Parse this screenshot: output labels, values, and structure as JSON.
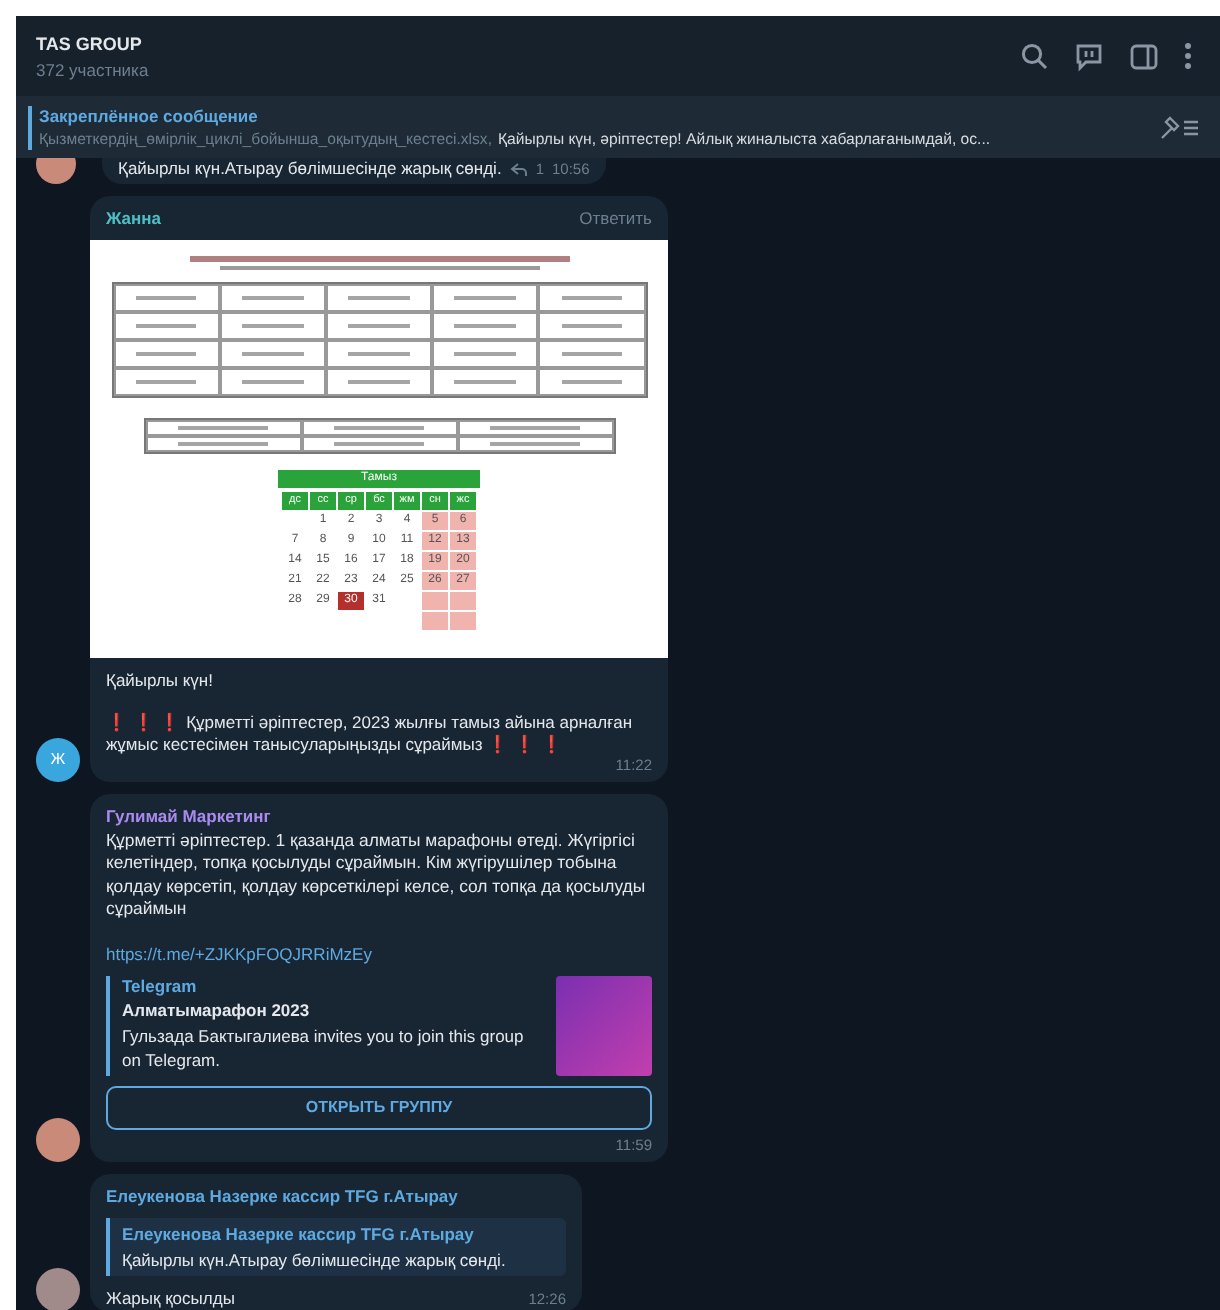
{
  "header": {
    "title": "TAS GROUP",
    "subtitle": "372 участника"
  },
  "pinned": {
    "label": "Закреплённое сообщение",
    "file": "Қызметкердің_өмірлік_циклі_бойынша_оқытудың_кестесі.xlsx,",
    "text": "Қайырлы күн, әріптестер! Айлық жиналыста хабарлағанымдай, ос..."
  },
  "messages": [
    {
      "kind": "partial",
      "text": "Қайырлы күн.Атырау бөлімшесінде жарық сөнді.",
      "replies": "1",
      "time": "10:56"
    },
    {
      "kind": "document",
      "author": "Жанна",
      "color": "#4fbfc6",
      "reply_action": "Ответить",
      "avatar": "Ж",
      "time": "11:22",
      "calendar": {
        "month": "Тамыз",
        "weekdays": [
          "дс",
          "сс",
          "ср",
          "бс",
          "жм",
          "сн",
          "жс"
        ],
        "weeks": [
          [
            {
              "weekend": false
            },
            {
              "day": "1",
              "weekend": false,
              "selected": false
            },
            {
              "day": "2",
              "weekend": false,
              "selected": false
            },
            {
              "day": "3",
              "weekend": false,
              "selected": false
            },
            {
              "day": "4",
              "weekend": false,
              "selected": false
            },
            {
              "day": "5",
              "weekend": true,
              "selected": false
            },
            {
              "day": "6",
              "weekend": true,
              "selected": false
            }
          ],
          [
            {
              "day": "7",
              "weekend": false,
              "selected": false
            },
            {
              "day": "8",
              "weekend": false,
              "selected": false
            },
            {
              "day": "9",
              "weekend": false,
              "selected": false
            },
            {
              "day": "10",
              "weekend": false,
              "selected": false
            },
            {
              "day": "11",
              "weekend": false,
              "selected": false
            },
            {
              "day": "12",
              "weekend": true,
              "selected": false
            },
            {
              "day": "13",
              "weekend": true,
              "selected": false
            }
          ],
          [
            {
              "day": "14",
              "weekend": false,
              "selected": false
            },
            {
              "day": "15",
              "weekend": false,
              "selected": false
            },
            {
              "day": "16",
              "weekend": false,
              "selected": false
            },
            {
              "day": "17",
              "weekend": false,
              "selected": false
            },
            {
              "day": "18",
              "weekend": false,
              "selected": false
            },
            {
              "day": "19",
              "weekend": true,
              "selected": false
            },
            {
              "day": "20",
              "weekend": true,
              "selected": false
            }
          ],
          [
            {
              "day": "21",
              "weekend": false,
              "selected": false
            },
            {
              "day": "22",
              "weekend": false,
              "selected": false
            },
            {
              "day": "23",
              "weekend": false,
              "selected": false
            },
            {
              "day": "24",
              "weekend": false,
              "selected": false
            },
            {
              "day": "25",
              "weekend": false,
              "selected": false
            },
            {
              "day": "26",
              "weekend": true,
              "selected": false
            },
            {
              "day": "27",
              "weekend": true,
              "selected": false
            }
          ],
          [
            {
              "day": "28",
              "weekend": false,
              "selected": false
            },
            {
              "day": "29",
              "weekend": false,
              "selected": false
            },
            {
              "day": "30",
              "weekend": false,
              "selected": true
            },
            {
              "day": "31",
              "weekend": false,
              "selected": false
            },
            {
              "weekend": false
            },
            {
              "weekend": true
            },
            {
              "weekend": true
            }
          ],
          [
            {
              "weekend": false
            },
            {
              "weekend": false
            },
            {
              "weekend": false
            },
            {
              "weekend": false
            },
            {
              "weekend": false
            },
            {
              "weekend": true
            },
            {
              "weekend": true
            }
          ]
        ]
      },
      "paragraphs": [
        [
          {
            "kind": "plain",
            "text": "Қайырлы күн!"
          }
        ],
        [
          {
            "kind": "alert",
            "text": "❗ ❗ ❗"
          },
          {
            "kind": "plain",
            "text": " Құрметті әріптестер, 2023 жылғы тамыз айына арналған жұмыс кестесімен танысуларыңызды сұраймыз "
          },
          {
            "kind": "alert",
            "text": "❗ ❗ ❗"
          }
        ]
      ]
    },
    {
      "kind": "link",
      "author": "Гулимай Маркетинг",
      "color": "#a98bef",
      "time": "11:59",
      "text": "Құрметті әріптестер. 1 қазанда алматы марафоны өтеді. Жүгіргісі келетіндер, топқа қосылуды сұраймын. Кім жүгірушілер тобына қолдау көрсетіп, қолдау көрсеткілері келсе, сол топқа да қосылуды сұраймын",
      "link": "https://t.me/+ZJKKpFOQJRRiMzEy",
      "preview": {
        "site": "Telegram",
        "title": "Алматымарафон 2023",
        "description": "Гульзада Бактыгалиева invites you to join this group on Telegram."
      },
      "button": "ОТКРЫТЬ ГРУППУ"
    },
    {
      "kind": "reply",
      "author": "Елеукенова Назерке кассир TFG г.Атырау",
      "color": "#5ea9e0",
      "time": "12:26",
      "quote": {
        "author": "Елеукенова Назерке кассир TFG г.Атырау",
        "text": "Қайырлы күн.Атырау бөлімшесінде жарық сөнді."
      },
      "text": "Жарық қосылды"
    }
  ]
}
